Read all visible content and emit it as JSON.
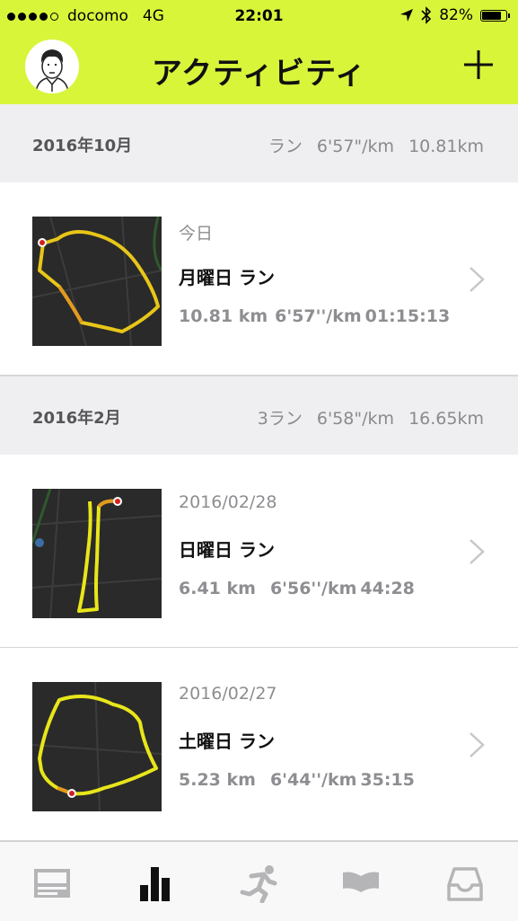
{
  "status_bar": {
    "carrier": "docomo",
    "network": "4G",
    "time": "22:01",
    "battery": "82%",
    "battery_level": 0.82
  },
  "nav": {
    "title": "アクティビティ",
    "avatar_icon": "avatar-icon",
    "add_icon": "plus-icon"
  },
  "accent_color": "#d8f53a",
  "sections": [
    {
      "month": "2016年10月",
      "summary": "ラン 6'57\"/km 10.81km",
      "activities": [
        {
          "date": "今日",
          "title": "月曜日 ラン",
          "distance": "10.81 km",
          "pace": "6'57''/km",
          "duration": "01:15:13"
        }
      ]
    },
    {
      "month": "2016年2月",
      "summary": "3ラン 6'58\"/km 16.65km",
      "activities": [
        {
          "date": "2016/02/28",
          "title": "日曜日 ラン",
          "distance": "6.41 km",
          "pace": "6'56''/km",
          "duration": "44:28"
        },
        {
          "date": "2016/02/27",
          "title": "土曜日 ラン",
          "distance": "5.23 km",
          "pace": "6'44''/km",
          "duration": "35:15"
        }
      ]
    }
  ],
  "tabs": [
    {
      "icon": "feed-icon",
      "active": false
    },
    {
      "icon": "activity-chart-icon",
      "active": true
    },
    {
      "icon": "runner-icon",
      "active": false
    },
    {
      "icon": "book-icon",
      "active": false
    },
    {
      "icon": "inbox-icon",
      "active": false
    }
  ]
}
